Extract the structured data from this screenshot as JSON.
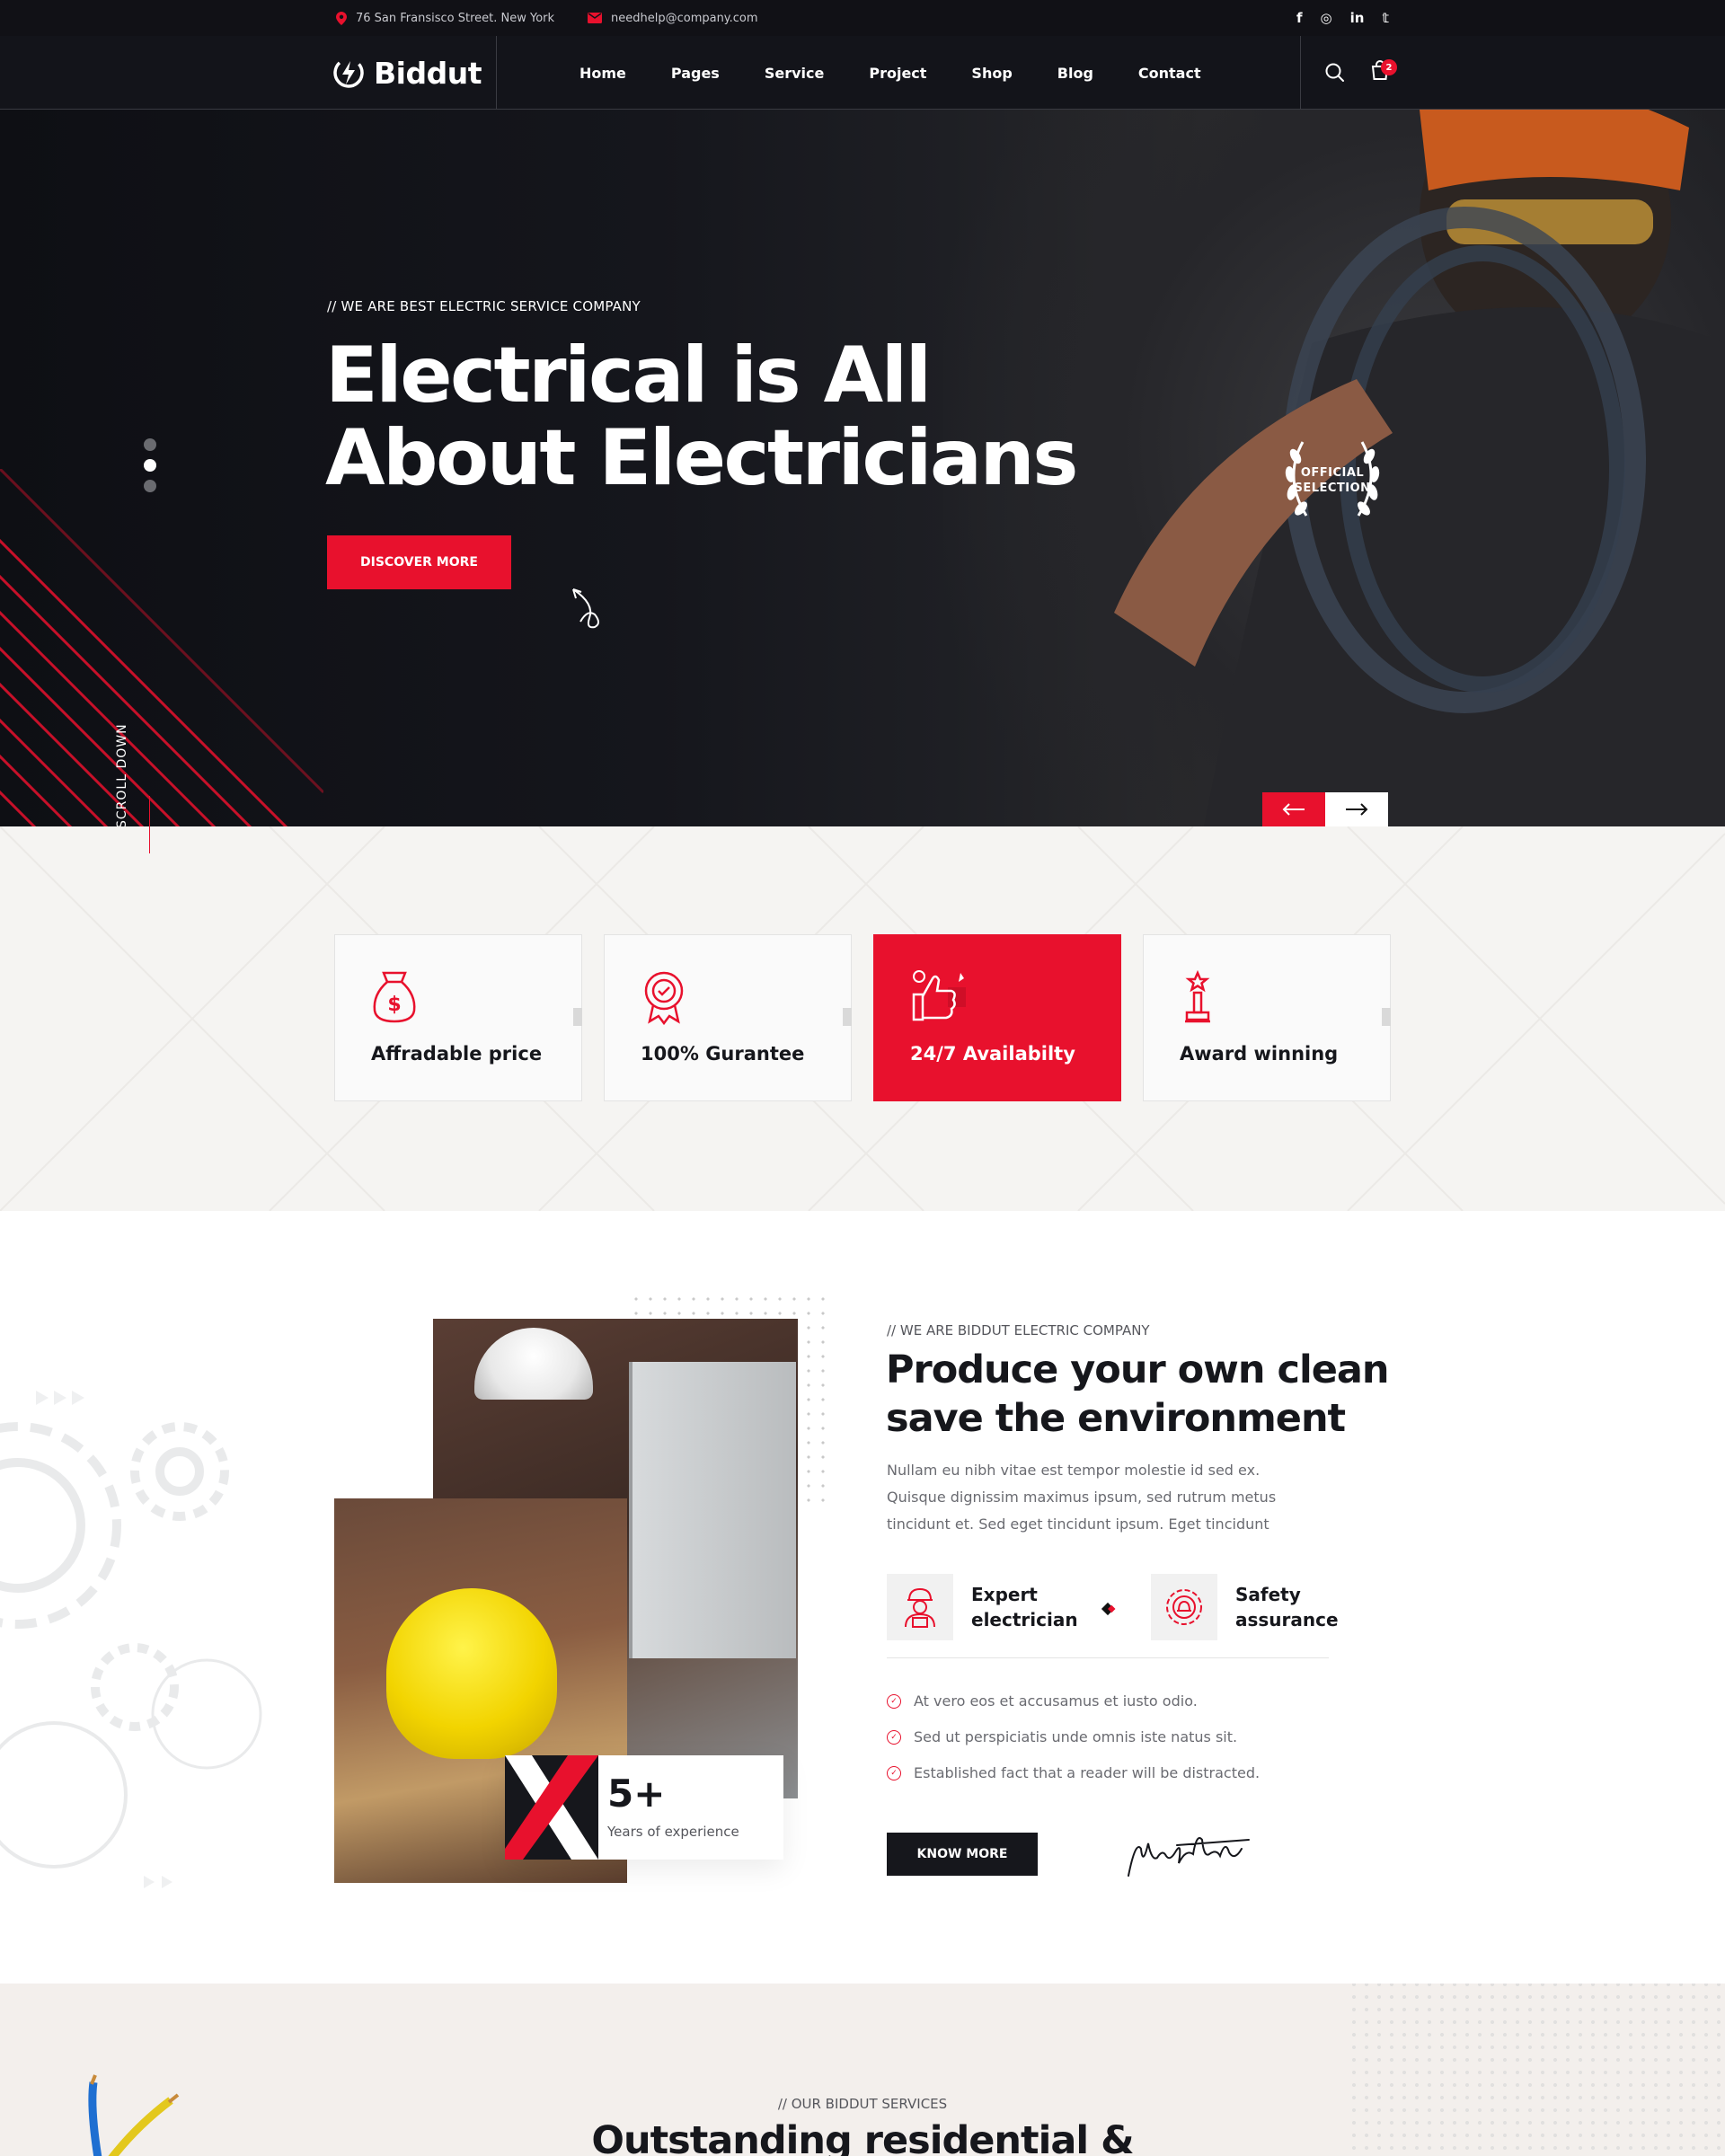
{
  "topbar": {
    "address": "76 San Fransisco Street. New York",
    "email": "needhelp@company.com",
    "social": [
      "facebook-icon",
      "instagram-icon",
      "linkedin-icon",
      "twitter-icon"
    ],
    "social_glyphs": [
      "f",
      "◎",
      "in",
      "𝕥"
    ]
  },
  "header": {
    "logo": "Biddut",
    "nav": [
      "Home",
      "Pages",
      "Service",
      "Project",
      "Shop",
      "Blog",
      "Contact"
    ],
    "cart_count": "2"
  },
  "hero": {
    "subtitle": "// WE ARE BEST ELECTRIC SERVICE COMPANY",
    "title_line1": "Electrical is All",
    "title_line2": "About Electricians",
    "button": "DISCOVER MORE",
    "scroll": "SCROLL DOWN",
    "badge_line1": "OFFICIAL",
    "badge_line2": "SELECTION"
  },
  "features": [
    {
      "label": "Affradable price",
      "icon": "money-bag-icon"
    },
    {
      "label": "100% Gurantee",
      "icon": "award-badge-icon"
    },
    {
      "label": "24/7 Availabilty",
      "icon": "thumbs-up-icon"
    },
    {
      "label": "Award winning",
      "icon": "trophy-icon"
    }
  ],
  "about": {
    "subtitle": "// WE ARE BIDDUT ELECTRIC COMPANY",
    "title": "Produce your own clean save the environment",
    "text": "Nullam eu nibh vitae est tempor molestie id sed ex. Quisque dignissim maximus ipsum, sed rutrum metus tincidunt et. Sed eget tincidunt ipsum. Eget tincidunt",
    "feature1_l1": "Expert",
    "feature1_l2": "electrician",
    "feature2_l1": "Safety",
    "feature2_l2": "assurance",
    "checks": [
      "At vero eos et accusamus et iusto odio.",
      "Sed ut perspiciatis unde omnis iste natus sit.",
      "Established fact that a reader will be distracted."
    ],
    "button": "KNOW MORE",
    "experience_num": "5+",
    "experience_text": "Years of experience"
  },
  "services": {
    "subtitle": "// OUR BIDDUT SERVICES",
    "title": "Outstanding residential &"
  },
  "colors": {
    "accent": "#e8112d",
    "dark": "#13141a"
  }
}
